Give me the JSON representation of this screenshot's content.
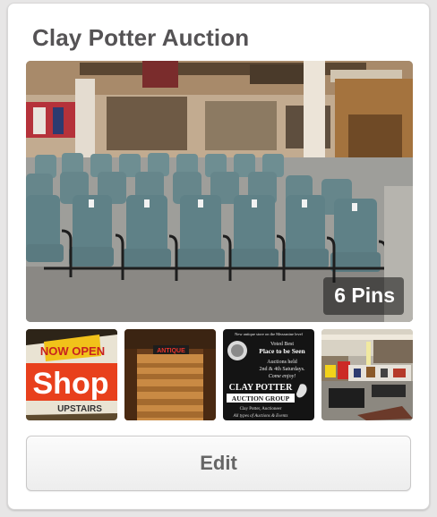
{
  "board": {
    "title": "Clay Potter Auction",
    "pin_count_label": "6 Pins",
    "edit_label": "Edit"
  },
  "thumbnails": {
    "shop": {
      "sign_top": "NOW OPEN",
      "sign_word": "Shop",
      "sign_bottom": "UPSTAIRS"
    },
    "stairs": {
      "sign": "ANTIQUE"
    },
    "flyer": {
      "top_line": "New antique store on the Mezzanine level",
      "voted_line": "Voted Best",
      "place_line": "Place to be Seen",
      "auction_line": "Auctions held",
      "dates_line": "2nd & 4th Saturdays.",
      "come_line": "Come enjoy!",
      "brand_line_1": "CLAY POTTER",
      "brand_line_2": "AUCTION GROUP",
      "auctioneer": "Clay Potter, Auctioneer",
      "types_line": "All types of Auctions & Events"
    }
  },
  "colors": {
    "title_text": "#555355",
    "edit_text": "#666666",
    "card_bg": "#ffffff",
    "page_bg": "#e7e6e6"
  }
}
